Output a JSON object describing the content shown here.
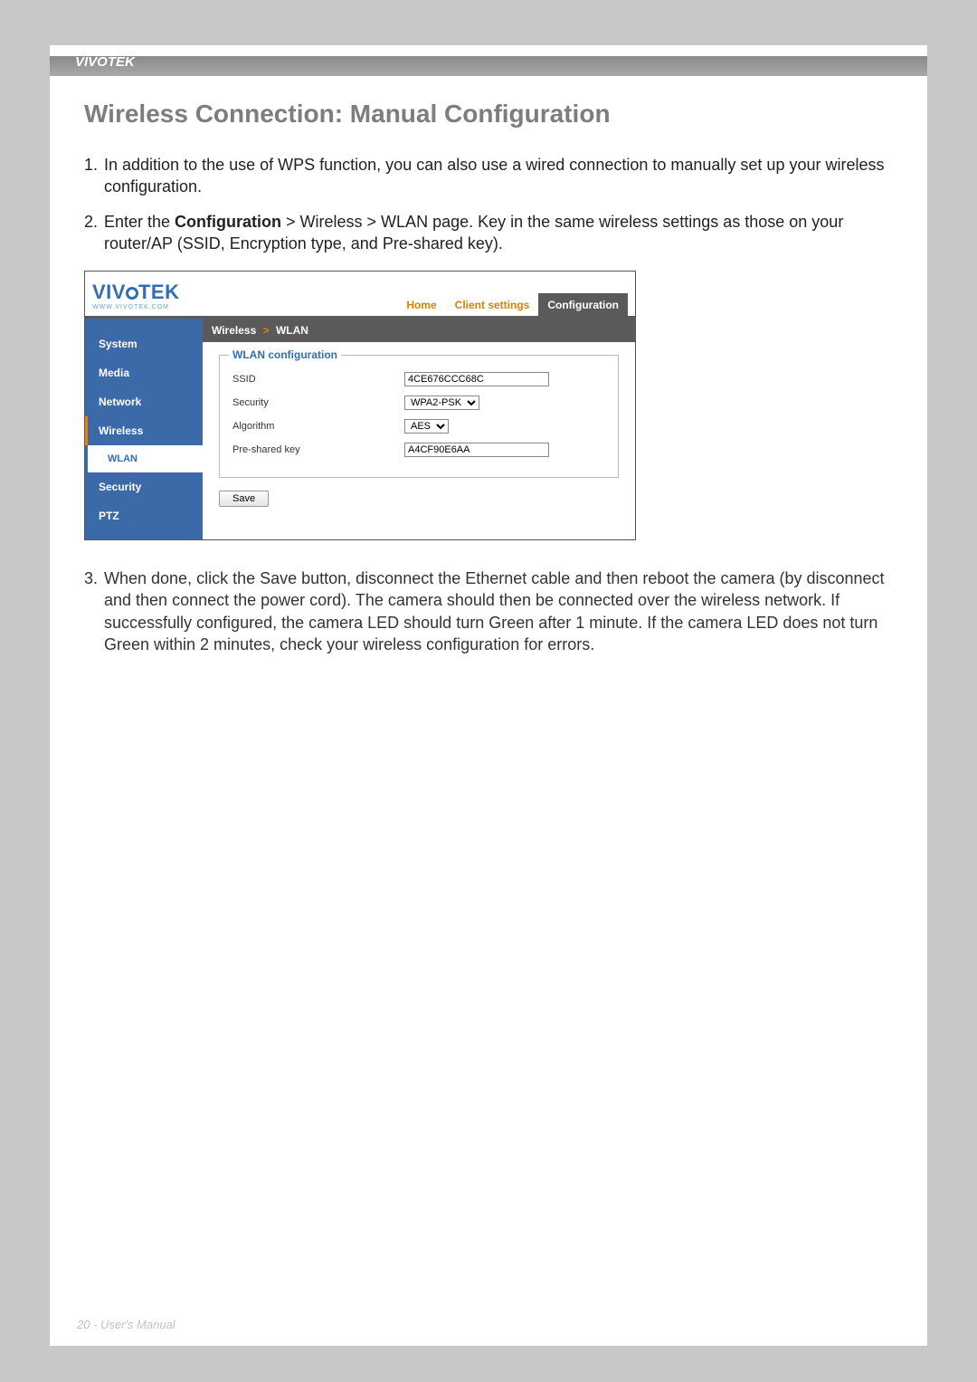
{
  "page_brand": "VIVOTEK",
  "section_title": "Wireless Connection: Manual Configuration",
  "step1": "In addition to the use of WPS function, you can also use a wired connection to manually set up your wireless configuration.",
  "step2_pre": "Enter the ",
  "step2_bold": "Configuration",
  "step2_post": " > Wireless > WLAN page. Key in the same wireless settings as those on your router/AP (SSID, Encryption type, and Pre-shared key).",
  "step3": "When done, click the Save button, disconnect the Ethernet cable and then reboot the camera (by disconnect and then connect the power cord). The camera should then be connected over the wireless network. If successfully configured, the camera LED should turn Green after 1 minute. If the camera LED does not turn Green within 2 minutes, check your wireless configuration for errors.",
  "shot": {
    "logo_main": "VIV   TEK",
    "logo_sub": "WWW.VIVOTEK.COM",
    "tabs": {
      "home": "Home",
      "client": "Client settings",
      "config": "Configuration"
    },
    "crumb_a": "Wireless",
    "crumb_sep": ">",
    "crumb_b": "WLAN",
    "sidebar": {
      "system": "System",
      "media": "Media",
      "network": "Network",
      "wireless": "Wireless",
      "wlan": "WLAN",
      "security": "Security",
      "ptz": "PTZ"
    },
    "legend": "WLAN configuration",
    "labels": {
      "ssid": "SSID",
      "security": "Security",
      "algorithm": "Algorithm",
      "psk": "Pre-shared key"
    },
    "values": {
      "ssid": "4CE676CCC68C",
      "security": "WPA2-PSK",
      "algorithm": "AES",
      "psk": "A4CF90E6AA"
    },
    "save": "Save"
  },
  "footer": "20 - User's Manual"
}
